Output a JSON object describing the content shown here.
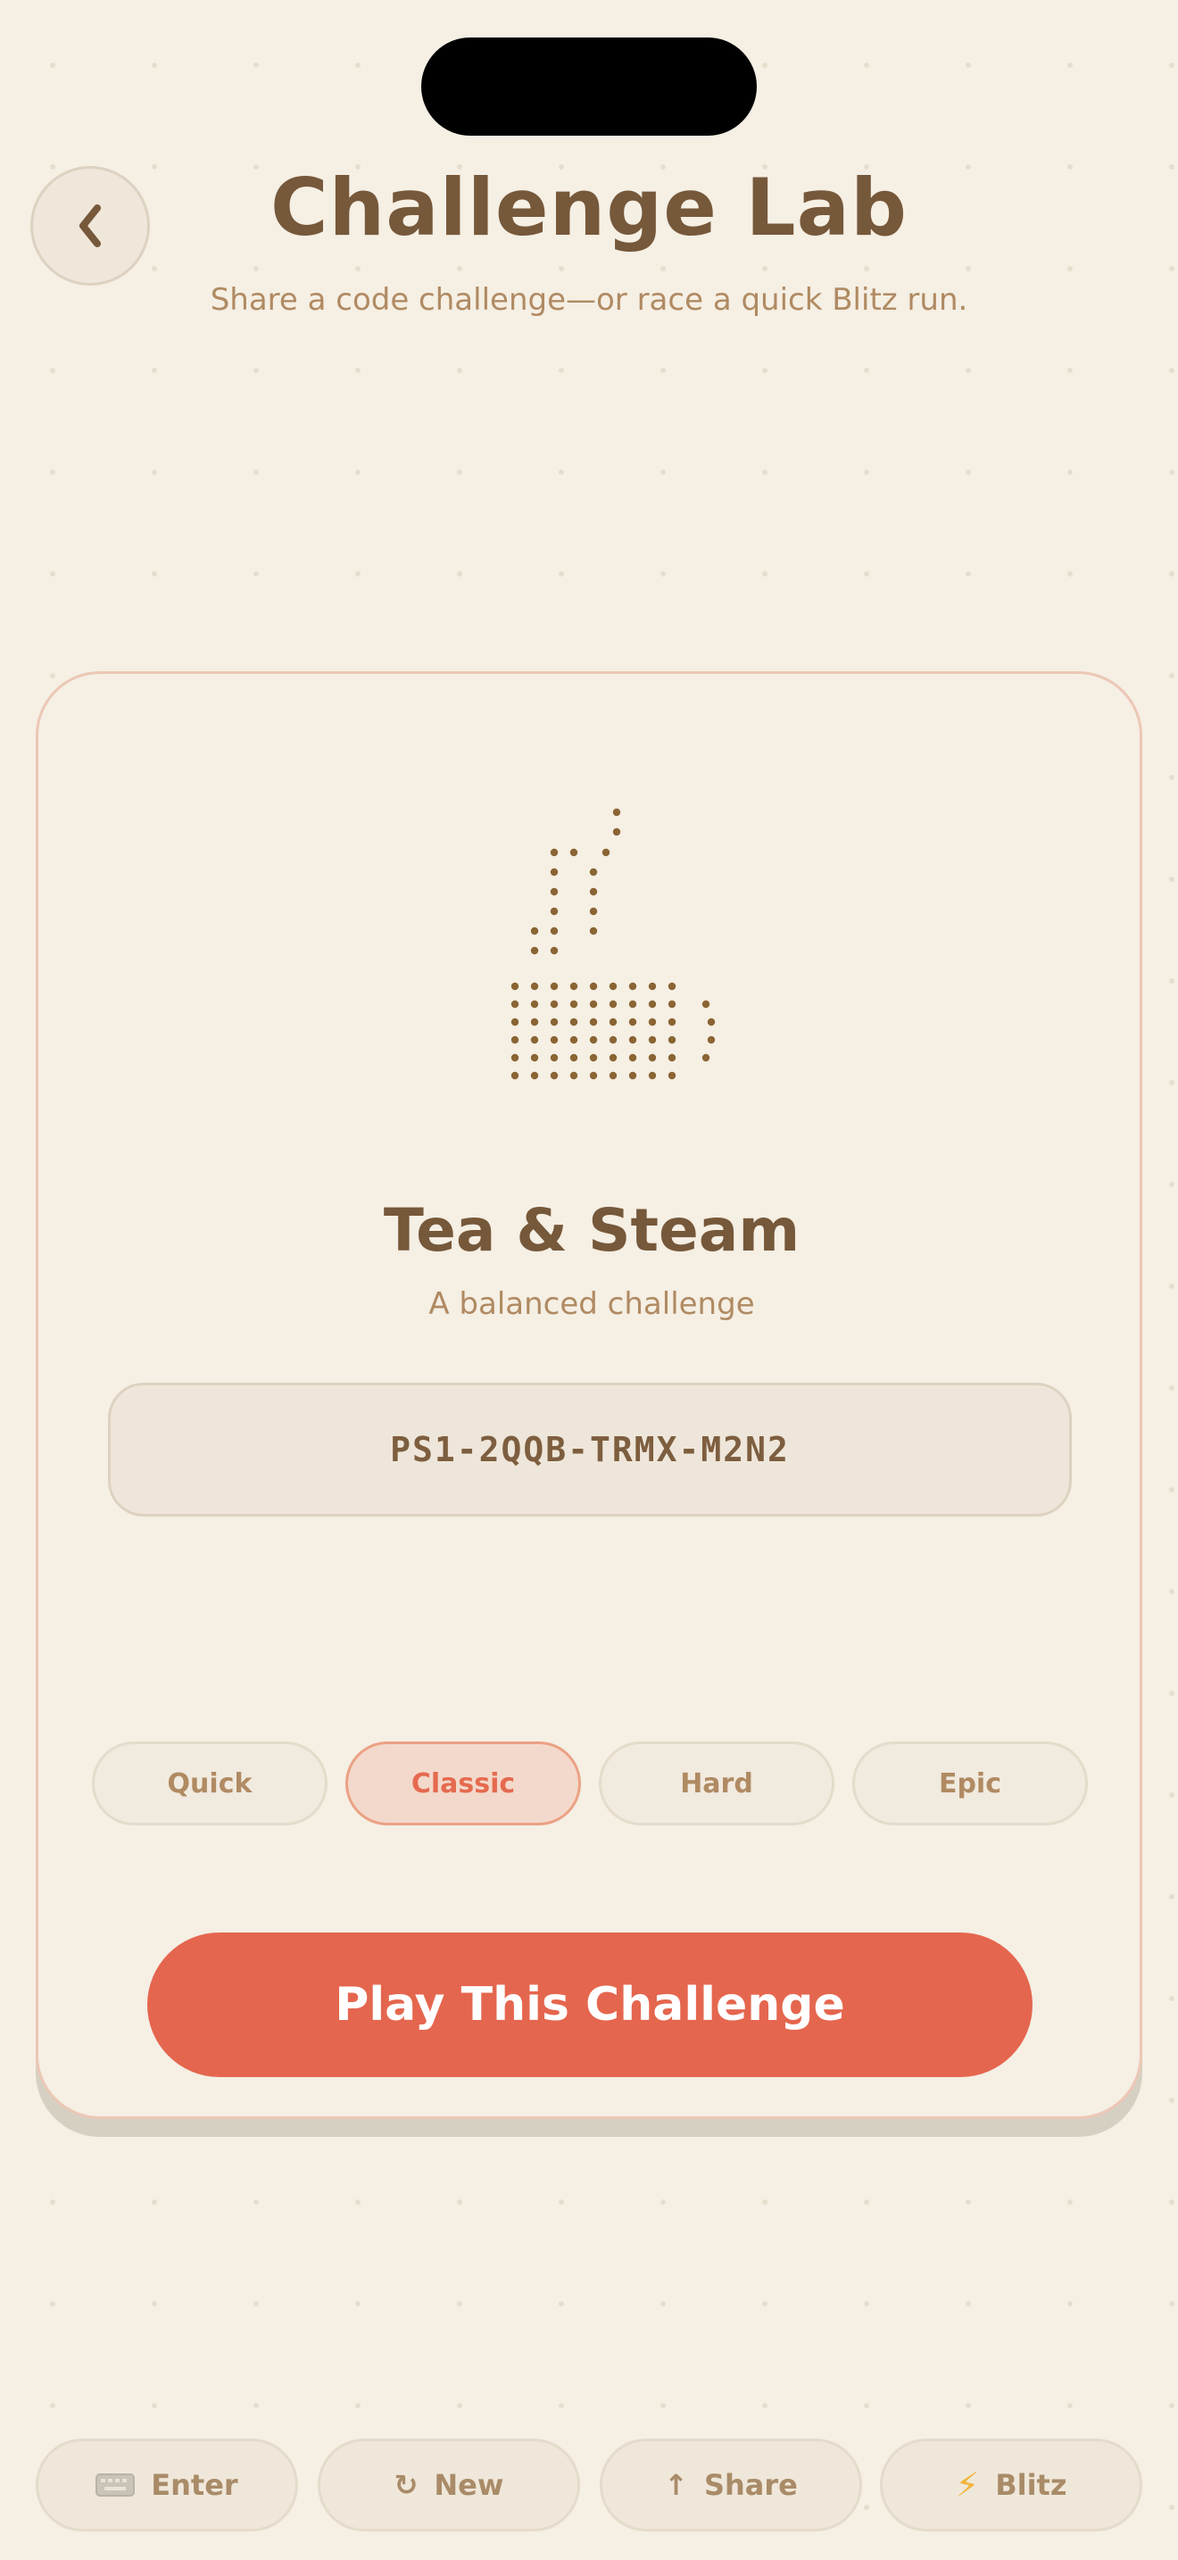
{
  "header": {
    "title": "Challenge Lab",
    "subtitle": "Share a code challenge—or race a quick Blitz run.",
    "back_icon": "chevron-left-icon"
  },
  "card": {
    "art_icon": "tea-cup-steam-icon",
    "title": "Tea & Steam",
    "subtitle": "A balanced challenge",
    "code": "PS1-2QQB-TRMX-M2N2",
    "difficulties": [
      {
        "label": "Quick",
        "selected": false
      },
      {
        "label": "Classic",
        "selected": true
      },
      {
        "label": "Hard",
        "selected": false
      },
      {
        "label": "Epic",
        "selected": false
      }
    ],
    "play_label": "Play This Challenge"
  },
  "toolbar": {
    "items": [
      {
        "label": "Enter",
        "icon": "keyboard-icon"
      },
      {
        "label": "New",
        "icon": "refresh-icon",
        "glyph": "↻"
      },
      {
        "label": "Share",
        "icon": "arrow-up-icon",
        "glyph": "↑"
      },
      {
        "label": "Blitz",
        "icon": "lightning-icon",
        "glyph": "⚡"
      }
    ]
  },
  "colors": {
    "background": "#f5efe4",
    "text_brown": "#76583a",
    "muted_tan": "#b08a62",
    "accent_coral": "#e5664e",
    "selected_pill_bg": "#f3d9cb",
    "dot_art": "#8a6433",
    "blitz_yellow": "#f2b43a"
  }
}
